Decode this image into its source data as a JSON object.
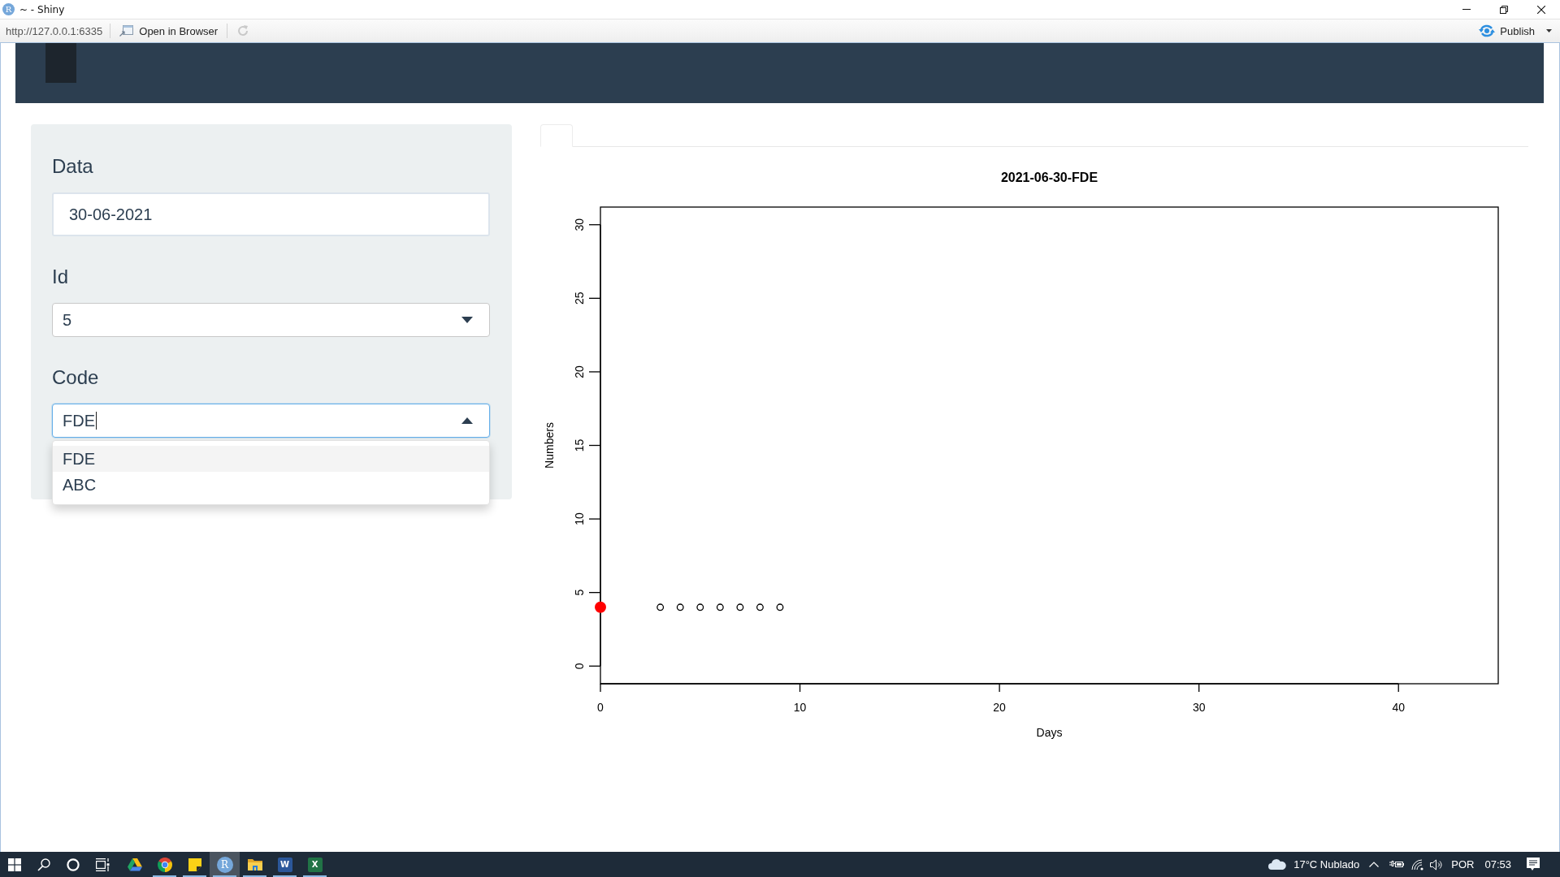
{
  "window": {
    "icon_letter": "R",
    "title": "~ - Shiny"
  },
  "toolbar": {
    "url": "http://127.0.0.1:6335",
    "open_in_browser": "Open in Browser",
    "reload": {
      "disabled": true
    },
    "publish": "Publish"
  },
  "sidebar": {
    "fields": [
      {
        "kind": "date",
        "label": "Data",
        "value": "30-06-2021"
      },
      {
        "kind": "select",
        "label": "Id",
        "value": "5",
        "expanded": false
      },
      {
        "kind": "select",
        "label": "Code",
        "value": "FDE",
        "expanded": true,
        "options": [
          {
            "label": "FDE",
            "selected": true
          },
          {
            "label": "ABC",
            "selected": false
          }
        ]
      }
    ]
  },
  "plot": {
    "chart_data": {
      "type": "scatter",
      "title": "2021-06-30-FDE",
      "xlabel": "Days",
      "ylabel": "Numbers",
      "x": [
        0,
        3,
        4,
        5,
        6,
        7,
        8,
        9
      ],
      "series": [
        {
          "color": "#ff0000",
          "values": [
            4,
            null,
            null,
            null,
            null,
            null,
            null,
            null
          ]
        },
        {
          "color": "#000000",
          "values": [
            null,
            4,
            4,
            4,
            4,
            4,
            4,
            4
          ]
        }
      ],
      "xlim": [
        0,
        45
      ],
      "ylim": [
        -1.2,
        31.2
      ],
      "xticks": [
        0,
        10,
        20,
        30,
        40
      ],
      "yticks": [
        0,
        5,
        10,
        15,
        20,
        25,
        30
      ]
    }
  },
  "taskbar": {
    "apps": [
      {
        "kind": "triangle",
        "running": false,
        "active": false
      },
      {
        "kind": "browser",
        "running": true,
        "active": false
      },
      {
        "kind": "note",
        "running": true,
        "active": false
      },
      {
        "kind": "badge",
        "letter": "R",
        "running": true,
        "active": true
      },
      {
        "kind": "folder",
        "running": true,
        "active": false
      },
      {
        "kind": "document",
        "letter": "W",
        "running": true,
        "active": false
      },
      {
        "kind": "spreadsheet",
        "letter": "X",
        "running": true,
        "active": false
      }
    ],
    "weather": "17°C Nublado",
    "language": "POR",
    "time": "07:53"
  }
}
